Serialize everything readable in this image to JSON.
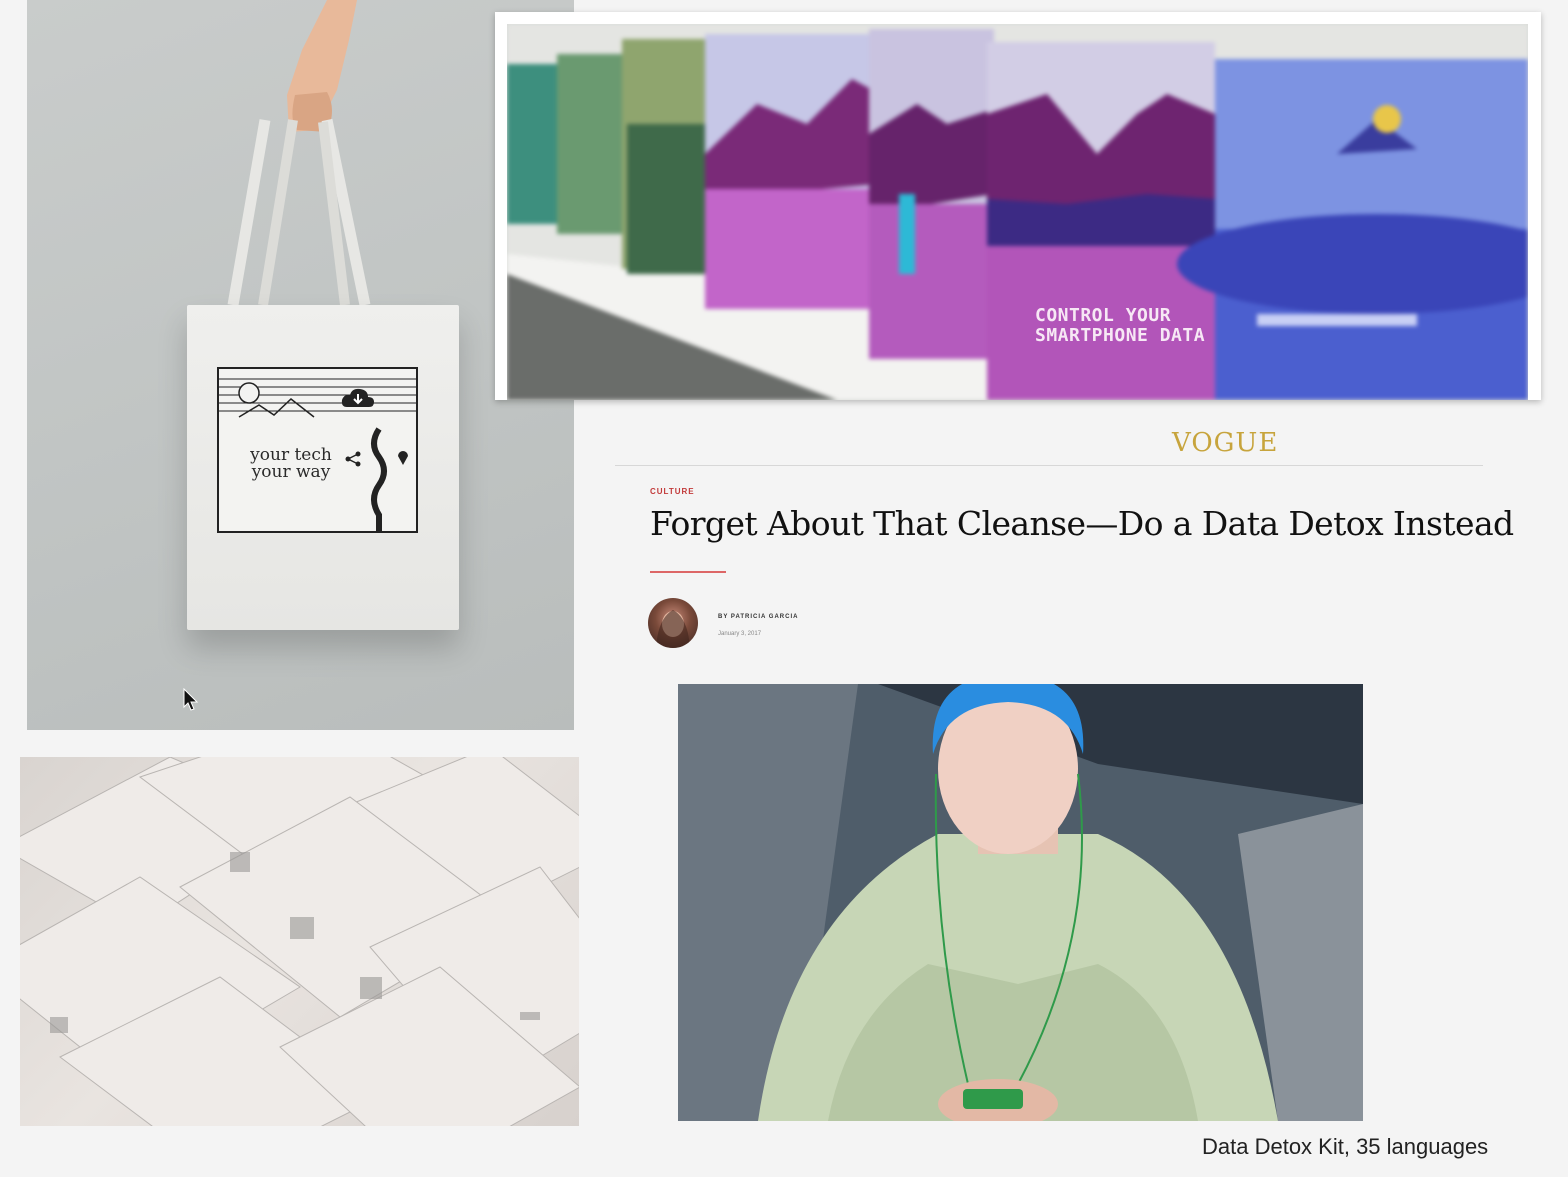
{
  "slide": {
    "caption": "Data Detox Kit, 35 languages"
  },
  "tote_bag": {
    "print_text_line1": "your tech",
    "print_text_line2": "your way"
  },
  "leaflets": {
    "title_line1": "CONTROL YOUR",
    "title_line2": "SMARTPHONE DATA"
  },
  "vogue_article": {
    "logo": "VOGUE",
    "category": "CULTURE",
    "headline": "Forget About That Cleanse—Do a Data Detox Instead",
    "byline": "BY PATRICIA GARCIA",
    "date": "January 3, 2017"
  },
  "colors": {
    "vogue_logo": "#c7a43c",
    "category_red": "#c23a3a",
    "leaflet_magenta": "#b255b9",
    "leaflet_blue": "#3a45b8",
    "hair_blue": "#2a8de0"
  },
  "icons": [
    "cloud-download-icon",
    "share-icon",
    "location-pin-icon",
    "mouse-pointer-icon"
  ]
}
